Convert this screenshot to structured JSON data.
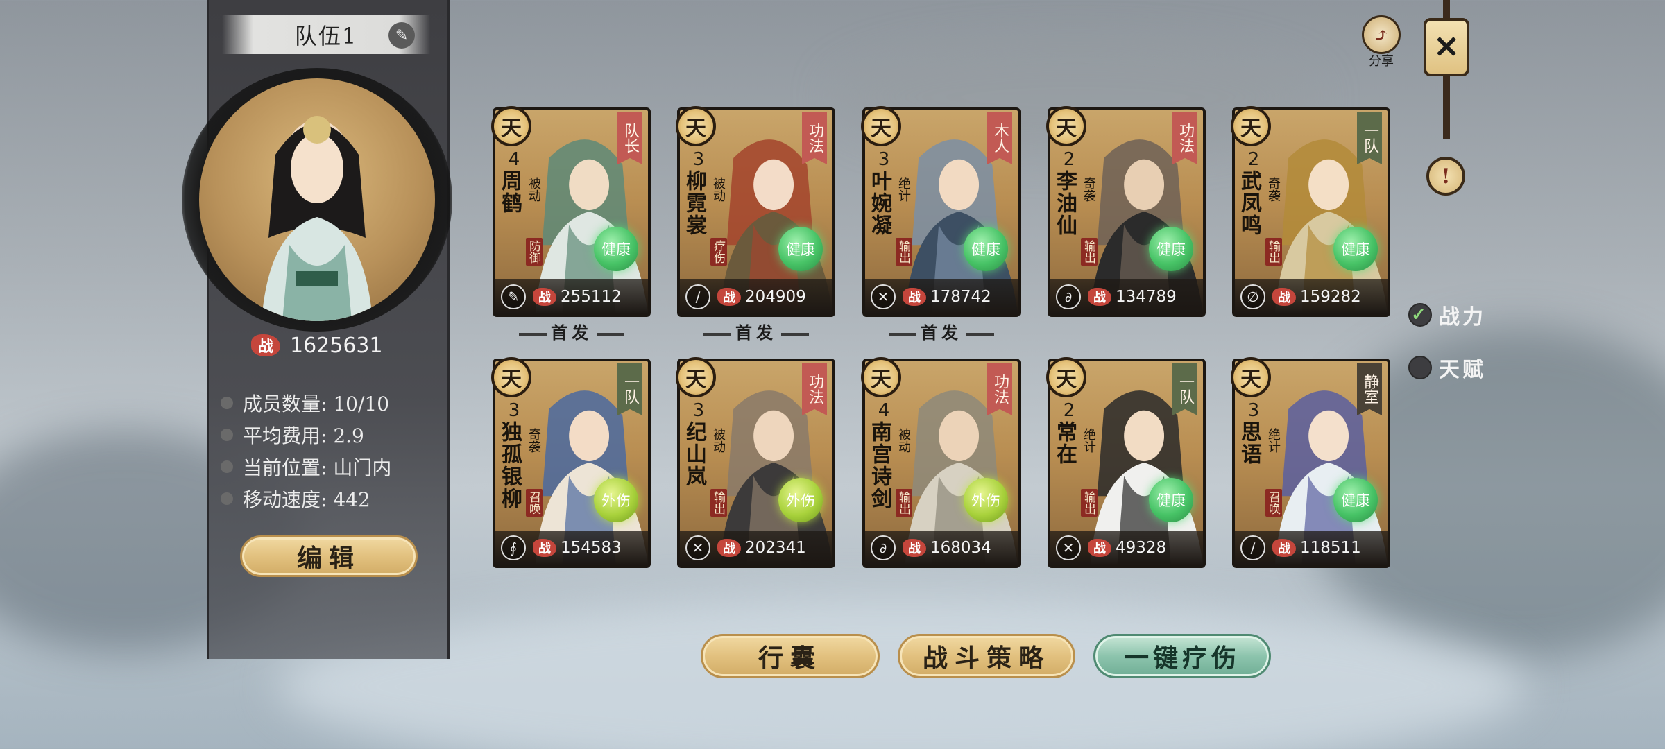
{
  "team": {
    "title": "队伍1",
    "total_power": "1625631",
    "stats": [
      {
        "label": "成员数量: 10/10"
      },
      {
        "label": "平均费用: 2.9"
      },
      {
        "label": "当前位置: 山门内"
      },
      {
        "label": "移动速度: 442"
      }
    ],
    "edit_label": "编辑"
  },
  "zhan": "战",
  "starter_label": "首发",
  "heroes": [
    {
      "grade": "天",
      "cost": "4",
      "name": "周鹤",
      "skill": "被动",
      "role": "防御",
      "tag": "队长",
      "status": "健康",
      "power": "255112",
      "weapon": "✎"
    },
    {
      "grade": "天",
      "cost": "3",
      "name": "柳霓裳",
      "skill": "被动",
      "role": "疗伤",
      "tag": "功法",
      "status": "健康",
      "power": "204909",
      "weapon": "∕"
    },
    {
      "grade": "天",
      "cost": "3",
      "name": "叶婉凝",
      "skill": "绝计",
      "role": "输出",
      "tag": "木人",
      "status": "健康",
      "power": "178742",
      "weapon": "✕"
    },
    {
      "grade": "天",
      "cost": "2",
      "name": "李油仙",
      "skill": "奇袭",
      "role": "输出",
      "tag": "功法",
      "status": "健康",
      "power": "134789",
      "weapon": "∂"
    },
    {
      "grade": "天",
      "cost": "2",
      "name": "武凤鸣",
      "skill": "奇袭",
      "role": "输出",
      "tag": "一队",
      "status": "健康",
      "power": "159282",
      "weapon": "∅"
    },
    {
      "grade": "天",
      "cost": "3",
      "name": "独孤银柳",
      "skill": "奇袭",
      "role": "召唤",
      "tag": "一队",
      "status": "外伤",
      "power": "154583",
      "weapon": "∮"
    },
    {
      "grade": "天",
      "cost": "3",
      "name": "纪山岚",
      "skill": "被动",
      "role": "输出",
      "tag": "功法",
      "status": "外伤",
      "power": "202341",
      "weapon": "✕"
    },
    {
      "grade": "天",
      "cost": "4",
      "name": "南宫诗剑",
      "skill": "被动",
      "role": "输出",
      "tag": "功法",
      "status": "外伤",
      "power": "168034",
      "weapon": "∂"
    },
    {
      "grade": "天",
      "cost": "2",
      "name": "常在",
      "skill": "绝计",
      "role": "输出",
      "tag": "一队",
      "status": "健康",
      "power": "49328",
      "weapon": "✕"
    },
    {
      "grade": "天",
      "cost": "3",
      "name": "思语",
      "skill": "绝计",
      "role": "召唤",
      "tag": "静室",
      "status": "健康",
      "power": "118511",
      "weapon": "∕"
    }
  ],
  "buttons": {
    "bag": "行囊",
    "strategy": "战斗策略",
    "heal": "一键疗伤"
  },
  "top_right": {
    "share_label": "分享",
    "share_icon": "share-icon",
    "close_symbol": "✕",
    "info_symbol": "!"
  },
  "sort": {
    "power": "战力",
    "talent": "天赋",
    "selected": "战力"
  }
}
